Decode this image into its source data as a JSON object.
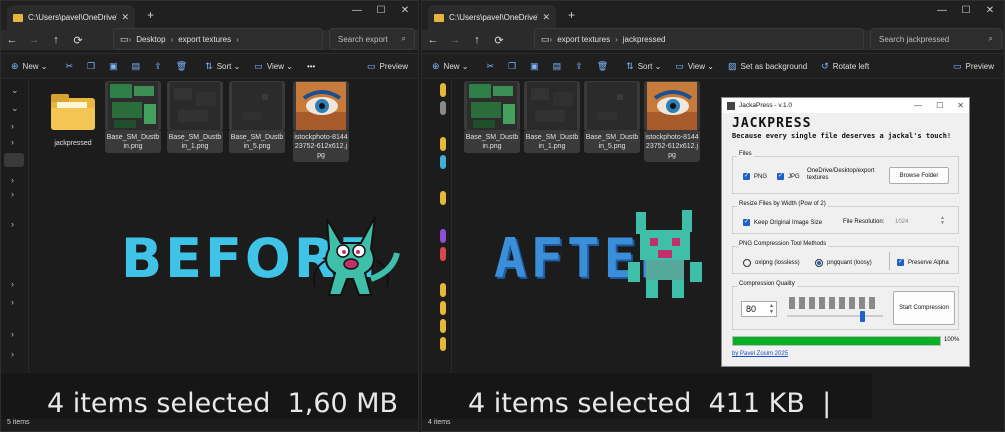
{
  "left": {
    "tab_title": "C:\\Users\\pavel\\OneDrive\\Desk",
    "breadcrumb": [
      "Desktop",
      "export textures"
    ],
    "search_placeholder": "Search export",
    "commands": [
      "New",
      "Sort",
      "View",
      "Preview"
    ],
    "files": [
      "jackpressed",
      "Base_SM_Dustbin.png",
      "Base_SM_Dustbin_1.png",
      "Base_SM_Dustbin_5.png",
      "istockphoto-814423752-612x612.jpg"
    ],
    "status": "5 items",
    "big_label": "BEFORE",
    "selection": "4 items selected",
    "size": "1,60 MB"
  },
  "right": {
    "tab_title": "C:\\Users\\pavel\\OneDrive\\Desk",
    "breadcrumb": [
      "export textures",
      "jackpressed"
    ],
    "search_placeholder": "Search jackpressed",
    "commands": [
      "New",
      "Sort",
      "View",
      "Set as background",
      "Rotate left",
      "Preview"
    ],
    "files": [
      "Base_SM_Dustbin.png",
      "Base_SM_Dustbin_1.png",
      "Base_SM_Dustbin_5.png",
      "istockphoto-814423752-612x612.jpg"
    ],
    "status": "4 items",
    "big_label": "AFTER",
    "selection": "4 items selected",
    "size": "411 KB"
  },
  "jackpress": {
    "window_title": "JackaPress - v.1.0",
    "heading": "JACKPRESS",
    "tagline": "Because every single file deserves a jackal's touch!",
    "files_group": "Files",
    "png": "PNG",
    "jpg": "JPG",
    "path": "OneDrive/Desktop/export textures",
    "browse": "Browse Folder",
    "resize_group": "Resize Files by Width (Pow of 2)",
    "keep_size": "Keep Original Image Size",
    "file_res_label": "File Resolution:",
    "file_res_value": "1024",
    "methods_group": "PNG Compression Tool Methods",
    "oxipng": "oxipng (lossless)",
    "pngquant": "pngquant (loosy)",
    "preserve_alpha": "Preserve Alpha",
    "quality_group": "Compression Quality",
    "quality_value": "80",
    "quality_level": 0.8,
    "start": "Start Compression",
    "progress": "100%",
    "progress_fraction": 1.0,
    "credit": "by Pavel Zosim 2025"
  },
  "colors": {
    "accent_text": "#3fc3e6",
    "pixel_text": "#3b8fd8",
    "folder": "#e8b63d",
    "progress": "#06b025",
    "mascot": "#3fbfa8"
  }
}
